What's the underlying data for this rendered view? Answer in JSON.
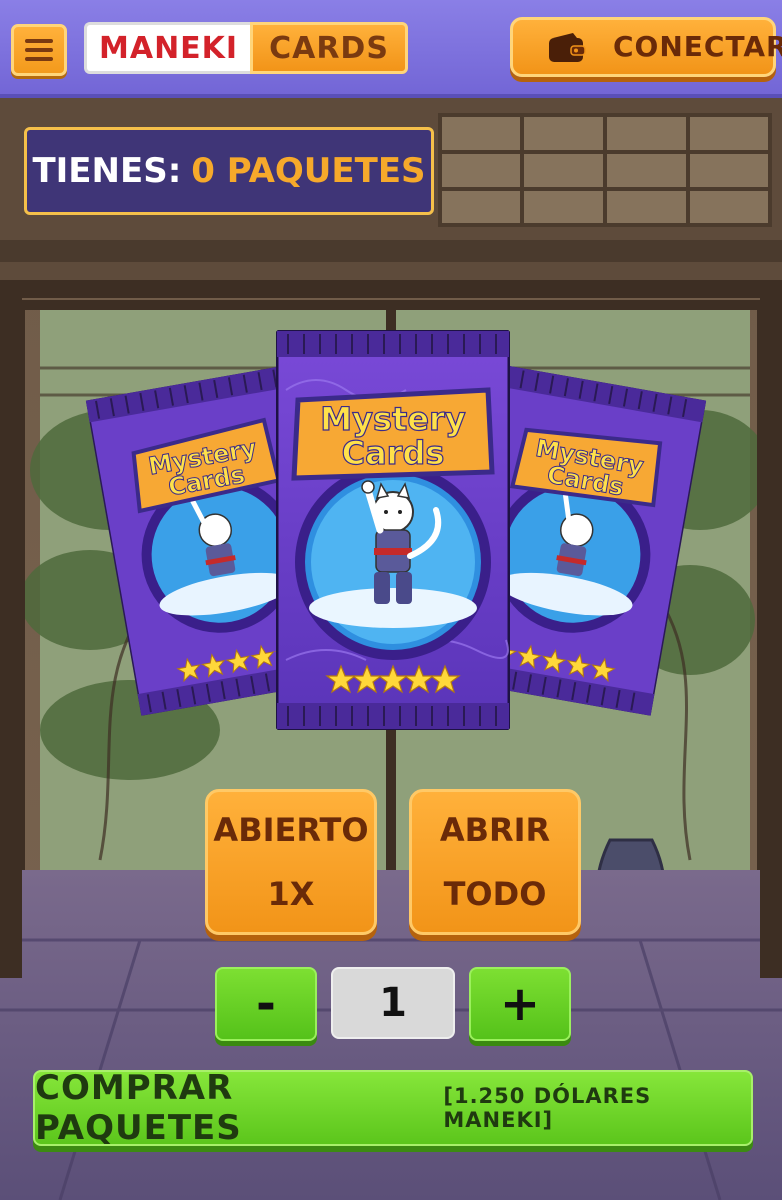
{
  "header": {
    "logo_left": "MANEKI",
    "logo_right": "CARDS",
    "connect_label": "CONECTAR"
  },
  "inventory": {
    "label": "TIENES:",
    "value": "0 PAQUETES"
  },
  "pack": {
    "title_line1": "Mystery",
    "title_line2": "Cards",
    "stars": 5
  },
  "actions": {
    "open_one_line1": "ABIERTO",
    "open_one_line2": "1X",
    "open_all_line1": "ABRIR",
    "open_all_line2": "TODO"
  },
  "stepper": {
    "minus_label": "-",
    "quantity": "1",
    "plus_label": "+"
  },
  "buy": {
    "label": "COMPRAR PAQUETES",
    "price": "[1.250 DÓLARES MANEKI]"
  },
  "colors": {
    "header_purple": "#7366d6",
    "accent_orange": "#f29418",
    "buy_green": "#5cc61c",
    "panel_navy": "#3f3577",
    "pack_purple": "#6a3fc8"
  }
}
